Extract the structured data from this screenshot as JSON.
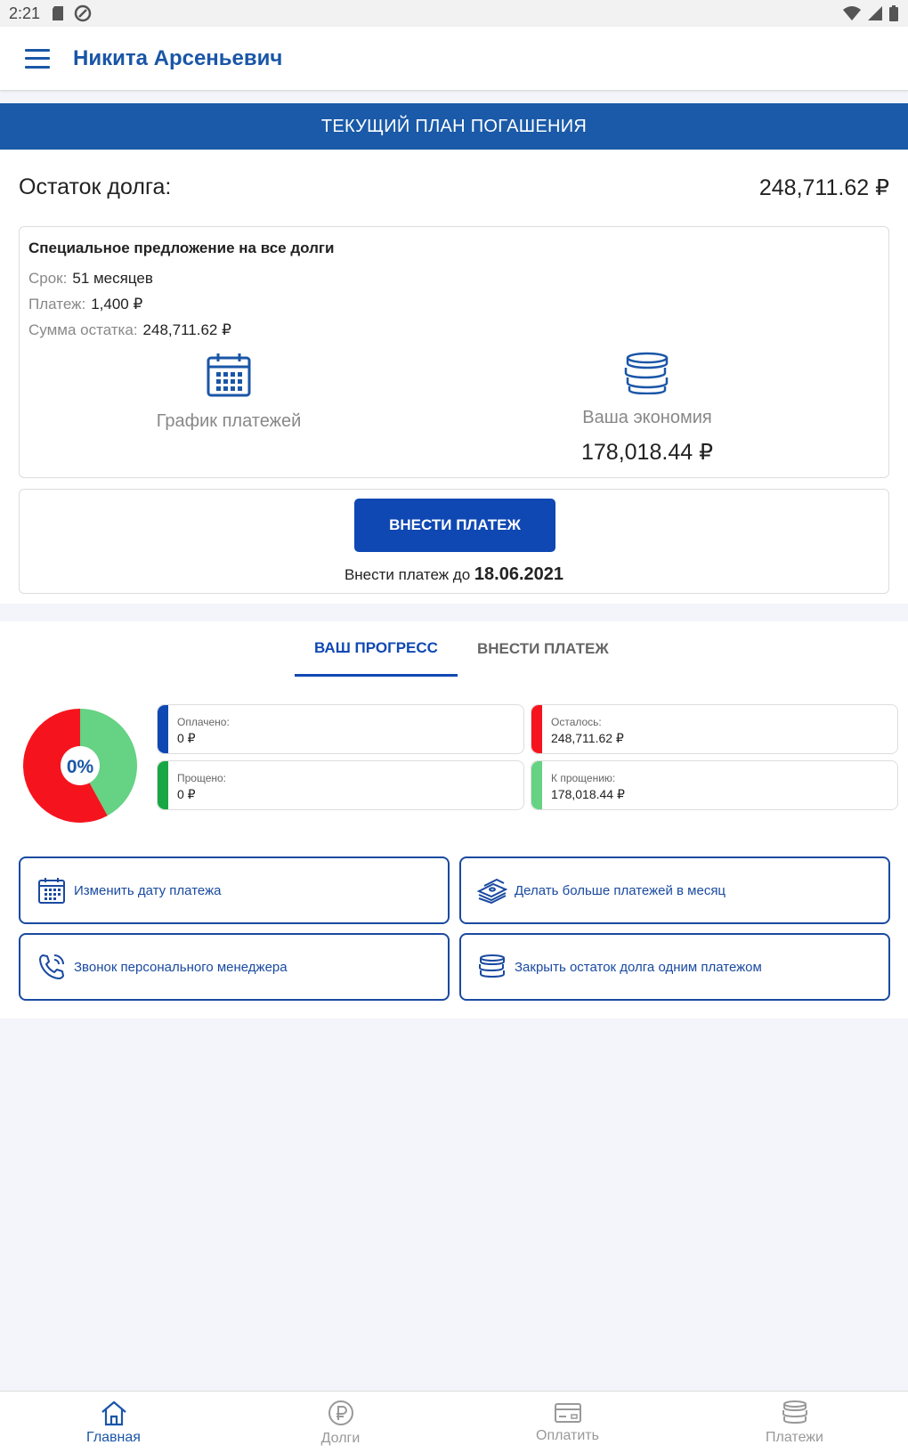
{
  "status_bar": {
    "time": "2:21"
  },
  "header": {
    "title": "Никита Арсеньевич"
  },
  "plan": {
    "banner": "ТЕКУЩИЙ ПЛАН ПОГАШЕНИЯ",
    "debt_label": "Остаток долга:",
    "debt_value": "248,711.62 ₽"
  },
  "offer": {
    "title": "Специальное предложение на все долги",
    "term_label": "Срок:",
    "term_value": "51 месяцев",
    "payment_label": "Платеж:",
    "payment_value": "1,400 ₽",
    "balance_label": "Сумма остатка:",
    "balance_value": "248,711.62 ₽",
    "schedule_label": "График платежей",
    "savings_label": "Ваша экономия",
    "savings_value": "178,018.44 ₽"
  },
  "payment": {
    "button_label": "ВНЕСТИ ПЛАТЕЖ",
    "due_prefix": "Внести платеж до",
    "due_date": "18.06.2021"
  },
  "tabs": [
    {
      "label": "ВАШ ПРОГРЕСС",
      "active": true
    },
    {
      "label": "ВНЕСТИ ПЛАТЕЖ",
      "active": false
    }
  ],
  "progress": {
    "percent_label": "0%",
    "chart": {
      "red_share": 0.58,
      "green_share": 0.42
    },
    "colors": {
      "red": "#f5141e",
      "green": "#65d284",
      "blue": "#0f48b3",
      "dark_green": "#18a744"
    },
    "stats": [
      {
        "label": "Оплачено:",
        "value": "0 ₽"
      },
      {
        "label": "Осталось:",
        "value": "248,711.62 ₽"
      },
      {
        "label": "Прощено:",
        "value": "0 ₽"
      },
      {
        "label": "К прощению:",
        "value": "178,018.44 ₽"
      }
    ]
  },
  "actions": [
    {
      "label": "Изменить дату платежа",
      "icon": "calendar-icon"
    },
    {
      "label": "Делать больше платежей в месяц",
      "icon": "money-stack-icon"
    },
    {
      "label": "Звонок персонального менеджера",
      "icon": "phone-icon"
    },
    {
      "label": "Закрыть остаток долга одним платежом",
      "icon": "coins-icon"
    }
  ],
  "bottom_nav": [
    {
      "label": "Главная",
      "icon": "home-icon",
      "active": true
    },
    {
      "label": "Долги",
      "icon": "ruble-icon",
      "active": false
    },
    {
      "label": "Оплатить",
      "icon": "card-icon",
      "active": false
    },
    {
      "label": "Платежи",
      "icon": "coins-icon",
      "active": false
    }
  ]
}
